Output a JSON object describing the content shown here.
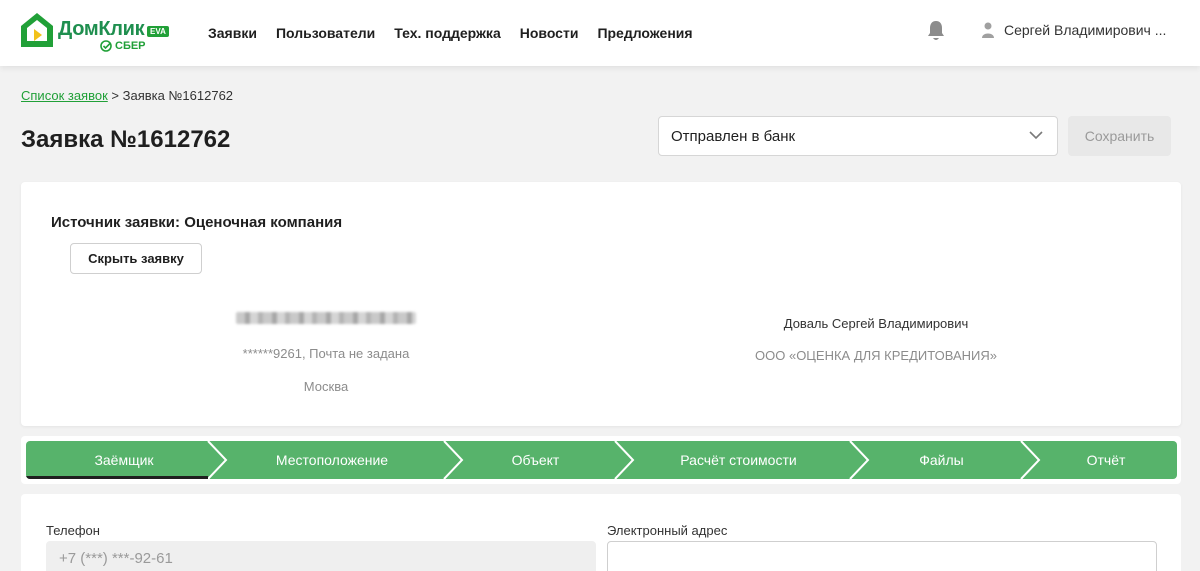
{
  "header": {
    "logo_name": "ДомКлик",
    "logo_badge": "EVA",
    "logo_sub": "СБЕР",
    "nav": [
      "Заявки",
      "Пользователи",
      "Тех. поддержка",
      "Новости",
      "Предложения"
    ],
    "user_name": "Сергей Владимирович ..."
  },
  "breadcrumb": {
    "link": "Список заявок",
    "separator": ">",
    "current": "Заявка №1612762"
  },
  "page": {
    "title": "Заявка №1612762",
    "status_value": "Отправлен в банк",
    "save_label": "Сохранить"
  },
  "source": {
    "title": "Источник заявки: Оценочная компания",
    "hide_label": "Скрыть заявку",
    "client_contact": "******9261, Почта не задана",
    "client_city": "Москва",
    "appraiser_name": "Доваль Сергей Владимирович",
    "appraiser_org": "ООО «ОЦЕНКА ДЛЯ КРЕДИТОВАНИЯ»"
  },
  "tabs": [
    "Заёмщик",
    "Местоположение",
    "Объект",
    "Расчёт стоимости",
    "Файлы",
    "Отчёт"
  ],
  "form": {
    "phone_label": "Телефон",
    "phone_value": "+7 (***) ***-92-61",
    "email_label": "Электронный адрес",
    "email_value": ""
  },
  "colors": {
    "brand_green": "#21a038",
    "tab_green": "#57b36b"
  }
}
